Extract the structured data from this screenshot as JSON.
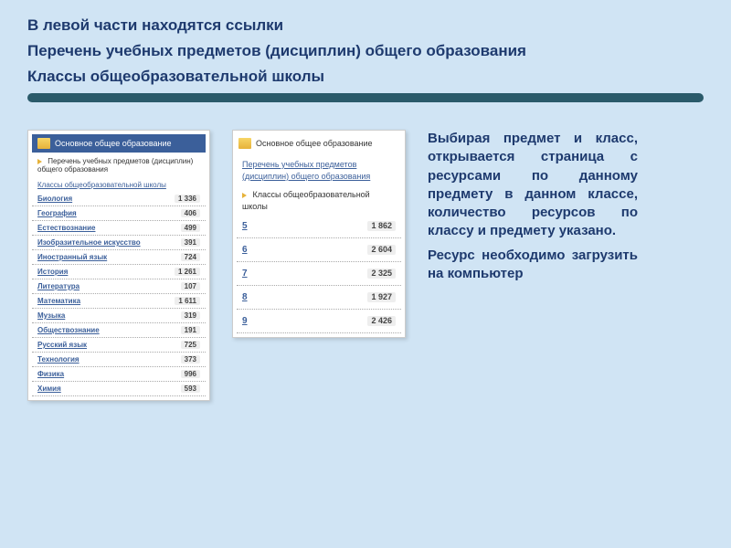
{
  "headings": {
    "line1": "В левой части находятся ссылки",
    "line2": "Перечень учебных предметов (дисциплин) общего образования",
    "line3": "Классы общеобразовательной школы"
  },
  "panelLeft": {
    "title": "Основное общее образование",
    "sub1": "Перечень учебных предметов (дисциплин) общего образования",
    "sub2": "Классы общеобразовательной школы",
    "subjects": [
      {
        "name": "Биология",
        "count": "1 336"
      },
      {
        "name": "География",
        "count": "406"
      },
      {
        "name": "Естествознание",
        "count": "499"
      },
      {
        "name": "Изобразительное искусство",
        "count": "391"
      },
      {
        "name": "Иностранный язык",
        "count": "724"
      },
      {
        "name": "История",
        "count": "1 261"
      },
      {
        "name": "Литература",
        "count": "107"
      },
      {
        "name": "Математика",
        "count": "1 611"
      },
      {
        "name": "Музыка",
        "count": "319"
      },
      {
        "name": "Обществознание",
        "count": "191"
      },
      {
        "name": "Русский язык",
        "count": "725"
      },
      {
        "name": "Технология",
        "count": "373"
      },
      {
        "name": "Физика",
        "count": "996"
      },
      {
        "name": "Химия",
        "count": "593"
      }
    ]
  },
  "panelRight": {
    "title": "Основное общее образование",
    "sub1": "Перечень учебных предметов (дисциплин) общего образования",
    "sub2": "Классы общеобразовательной школы",
    "classes": [
      {
        "name": "5",
        "count": "1 862"
      },
      {
        "name": "6",
        "count": "2 604"
      },
      {
        "name": "7",
        "count": "2 325"
      },
      {
        "name": "8",
        "count": "1 927"
      },
      {
        "name": "9",
        "count": "2 426"
      }
    ]
  },
  "rightText": {
    "p1": "Выбирая предмет и класс, открывается страница с ресурсами по данному предмету в данном классе, количество ресурсов по классу и предмету указано.",
    "p2": "Ресурс необходимо загрузить на компьютер"
  }
}
